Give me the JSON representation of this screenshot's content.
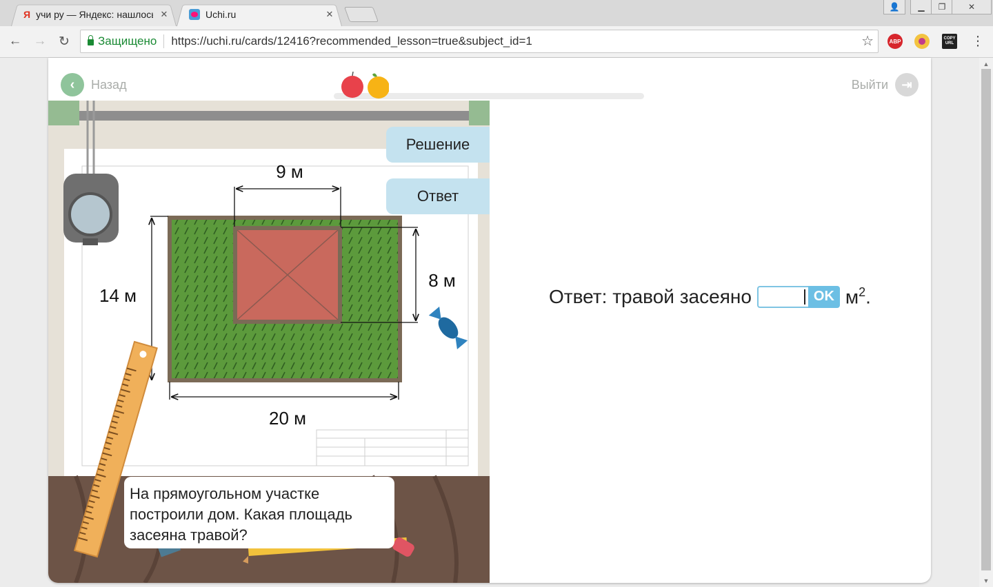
{
  "browser": {
    "tabs": [
      {
        "favicon": "Я",
        "title": "учи ру — Яндекс: нашлось",
        "close": "✕"
      },
      {
        "favicon": "uchi-favicon",
        "title": "Uchi.ru",
        "close": "✕"
      }
    ],
    "secure_label": "Защищено",
    "url": "https://uchi.ru/cards/12416?recommended_lesson=true&subject_id=1",
    "extensions": [
      "ABP",
      "COPY URL"
    ]
  },
  "lesson": {
    "back_label": "Назад",
    "exit_label": "Выйти",
    "solution_label": "Решение",
    "answer_button_label": "Ответ",
    "question": [
      "На прямоугольном участке",
      "построили дом. Какая площадь",
      "засеяна травой?"
    ],
    "answer_prefix": "Ответ: травой засеяно",
    "ok_label": "OK",
    "unit": "м",
    "unit_power": "2",
    "unit_suffix": "."
  },
  "figure": {
    "plot_width": "20 м",
    "plot_height": "14 м",
    "house_width": "9 м",
    "house_height": "8 м",
    "colors": {
      "grass": "#5c9a3c",
      "house": "#c9695d",
      "border": "#7b6a56"
    }
  },
  "colors": {
    "accent_blue": "#6cbfe4",
    "button_bg": "#c4e2ef",
    "green_button": "#8fc49b"
  }
}
